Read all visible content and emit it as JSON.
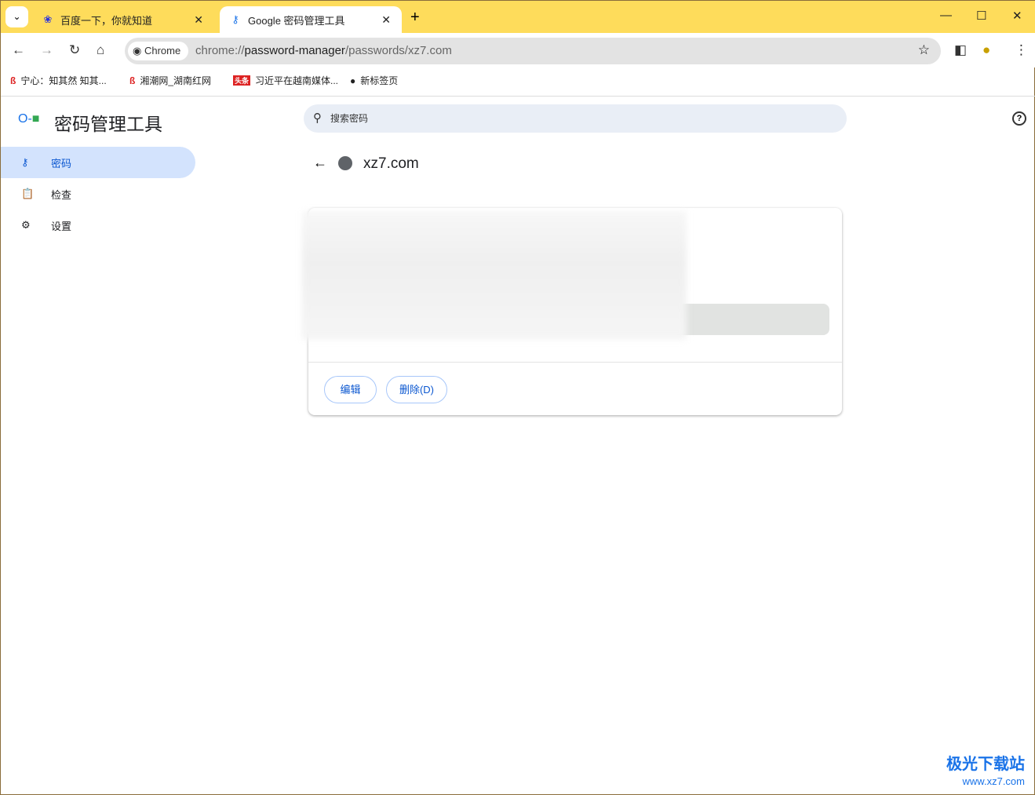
{
  "tabs": [
    {
      "label": "百度一下，你就知道",
      "icon": "baidu-paw-icon"
    },
    {
      "label": "Google 密码管理工具",
      "icon": "key-icon"
    }
  ],
  "omnibox": {
    "chip": "Chrome",
    "url_scheme": "chrome://",
    "url_host": "password-manager",
    "url_path": "/passwords/xz7.com"
  },
  "bookmarks": [
    "宁心：知其然 知其...",
    "湘潮网_湖南红网",
    "习近平在越南媒体...",
    "新标签页"
  ],
  "app": {
    "title": "密码管理工具",
    "search_placeholder": "搜索密码"
  },
  "sidebar": {
    "items": [
      {
        "label": "密码",
        "icon": "key-icon",
        "active": true
      },
      {
        "label": "检查",
        "icon": "checkup-icon"
      },
      {
        "label": "设置",
        "icon": "gear-icon"
      }
    ]
  },
  "detail": {
    "site": "xz7.com",
    "edit_label": "编辑",
    "delete_label": "删除(D)"
  },
  "watermark": {
    "name": "极光下载站",
    "url": "www.xz7.com"
  }
}
